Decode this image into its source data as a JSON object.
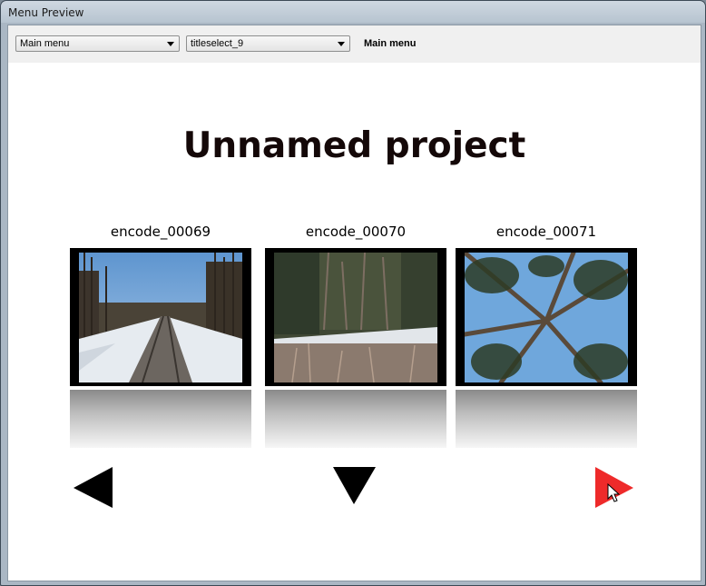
{
  "window": {
    "title": "Menu Preview"
  },
  "toolbar": {
    "menu_select": "Main menu",
    "title_select": "titleselect_9",
    "current_label": "Main menu"
  },
  "menu": {
    "title": "Unnamed project",
    "items": [
      {
        "label": "encode_00069",
        "scene": "snowy railway track"
      },
      {
        "label": "encode_00070",
        "scene": "forest edge with snow"
      },
      {
        "label": "encode_00071",
        "scene": "pine trees against sky"
      }
    ],
    "nav": {
      "prev": "prev-arrow-icon",
      "down": "down-arrow-icon",
      "next": "next-arrow-icon"
    }
  },
  "colors": {
    "next_highlight": "#ee2a2a",
    "arrow": "#000000",
    "title": "#140808"
  }
}
